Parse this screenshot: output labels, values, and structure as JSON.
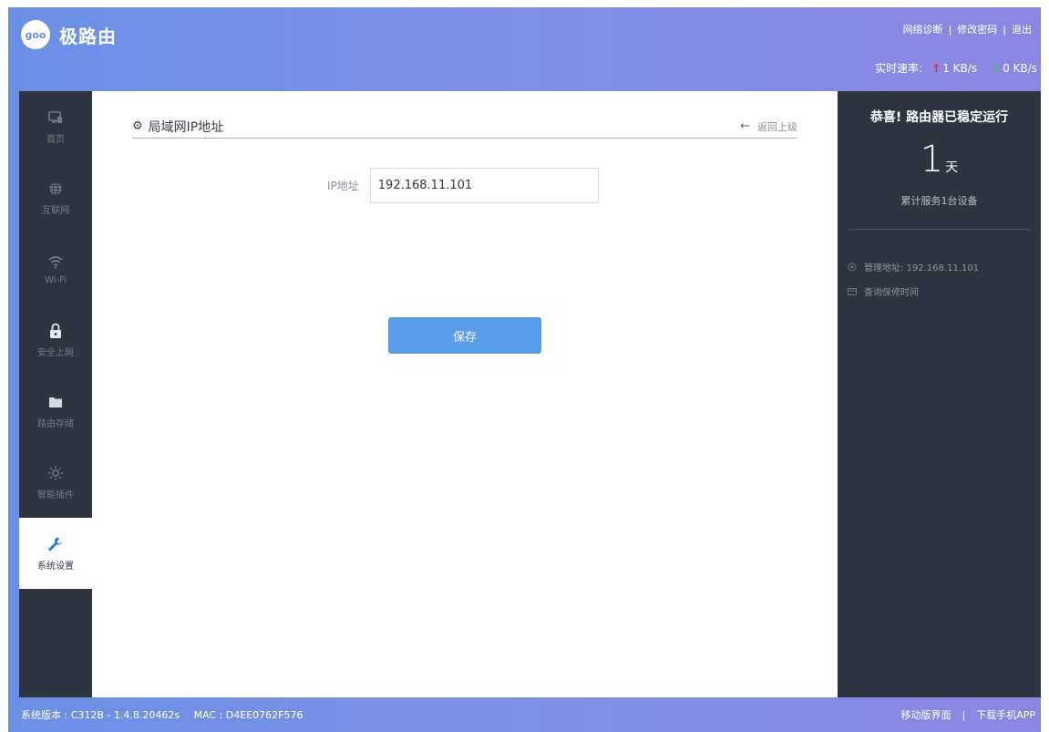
{
  "brand": {
    "logo_text": "goo",
    "name": "极路由"
  },
  "top_links": [
    "网络诊断",
    "修改密码",
    "退出"
  ],
  "speed": {
    "label": "实时速率:",
    "up": "1 KB/s",
    "down": "0 KB/s",
    "up_color": "#e8262b",
    "down_color": "#3ac840"
  },
  "sidebar": {
    "items": [
      {
        "label": "首页",
        "icon": "monitor-icon"
      },
      {
        "label": "互联网",
        "icon": "globe-icon"
      },
      {
        "label": "Wi-Fi",
        "icon": "wifi-icon"
      },
      {
        "label": "安全上网",
        "icon": "lock-icon"
      },
      {
        "label": "路由存储",
        "icon": "folder-icon"
      },
      {
        "label": "智能插件",
        "icon": "sun-icon"
      },
      {
        "label": "系统设置",
        "icon": "wrench-icon",
        "active": true
      }
    ]
  },
  "main": {
    "title": "局域网IP地址",
    "back_label": "返回上级",
    "field_label": "IP地址",
    "ip_value": "192.168.11.101",
    "save_label": "保存"
  },
  "right_panel": {
    "congrats": "恭喜! 路由器已稳定运行",
    "days_number": "1",
    "days_unit": "天",
    "served": "累计服务1台设备",
    "manage_address": "管理地址: 192.168.11.101",
    "warranty": "查询保修时间"
  },
  "footer": {
    "version": "系统版本 : C312B - 1.4.8.20462s",
    "mac": "MAC : D4EE0762F576",
    "mobile": "移动版界面",
    "app": "下载手机APP"
  },
  "colors": {
    "accent": "#5a9ce8",
    "sidebar_bg": "#2f3540",
    "header_gradient_start": "#6a90e6",
    "header_gradient_end": "#8b86e2"
  }
}
